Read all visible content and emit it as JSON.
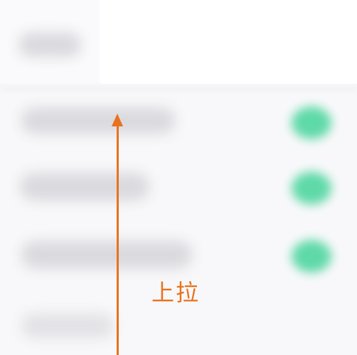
{
  "gesture": {
    "hint_text": "上拉",
    "direction_icon": "arrow-up-icon",
    "accent_color": "#e8721e"
  },
  "list": {
    "toggle_color": "#5fd9a8"
  }
}
